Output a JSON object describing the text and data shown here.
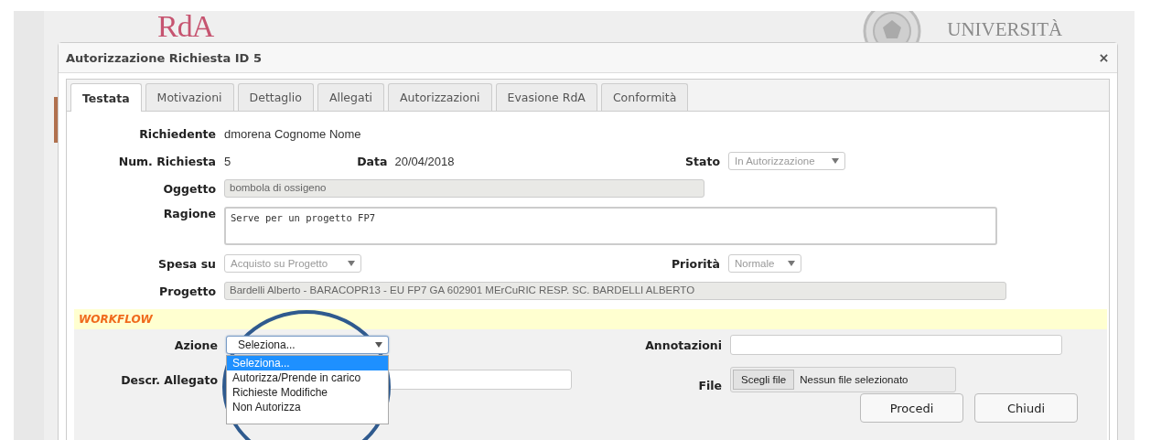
{
  "page": {
    "logo": "RdA",
    "university": "UNIVERSITÀ"
  },
  "dialog": {
    "title": "Autorizzazione Richiesta ID 5"
  },
  "tabs": [
    {
      "label": "Testata",
      "selected": true
    },
    {
      "label": "Motivazioni",
      "selected": false
    },
    {
      "label": "Dettaglio",
      "selected": false
    },
    {
      "label": "Allegati",
      "selected": false
    },
    {
      "label": "Autorizzazioni",
      "selected": false
    },
    {
      "label": "Evasione RdA",
      "selected": false
    },
    {
      "label": "Conformità",
      "selected": false
    }
  ],
  "testata": {
    "richiedente": {
      "label": "Richiedente",
      "value": "dmorena Cognome Nome"
    },
    "num_richiesta": {
      "label": "Num. Richiesta",
      "value": "5"
    },
    "data": {
      "label": "Data",
      "value": "20/04/2018"
    },
    "stato": {
      "label": "Stato",
      "value": "In Autorizzazione",
      "disabled": true
    },
    "oggetto": {
      "label": "Oggetto",
      "value": "bombola di ossigeno",
      "disabled": true
    },
    "ragione": {
      "label": "Ragione",
      "value": "Serve per un progetto FP7"
    },
    "spesa_su": {
      "label": "Spesa su",
      "value": "Acquisto su Progetto",
      "disabled": true
    },
    "priorita": {
      "label": "Priorità",
      "value": "Normale",
      "disabled": true
    },
    "progetto": {
      "label": "Progetto",
      "value": "Bardelli Alberto - BARACOPR13 - EU FP7 GA 602901 MErCuRIC RESP. SC. BARDELLI ALBERTO",
      "disabled": true
    }
  },
  "workflow": {
    "title": "WORKFLOW",
    "azione": {
      "label": "Azione",
      "value": "Seleziona...",
      "expanded": true,
      "options": [
        {
          "label": "Seleziona...",
          "selected": true
        },
        {
          "label": "Autorizza/Prende in carico",
          "selected": false
        },
        {
          "label": "Richieste Modifiche",
          "selected": false
        },
        {
          "label": "Non Autorizza",
          "selected": false
        }
      ]
    },
    "annotazioni": {
      "label": "Annotazioni"
    },
    "descr_allegato": {
      "label": "Descr. Allegato"
    },
    "file": {
      "label": "File",
      "button": "Scegli file",
      "status": "Nessun file selezionato"
    },
    "buttons": [
      "Procedi",
      "Chiudi"
    ]
  },
  "annotation_circle": true
}
